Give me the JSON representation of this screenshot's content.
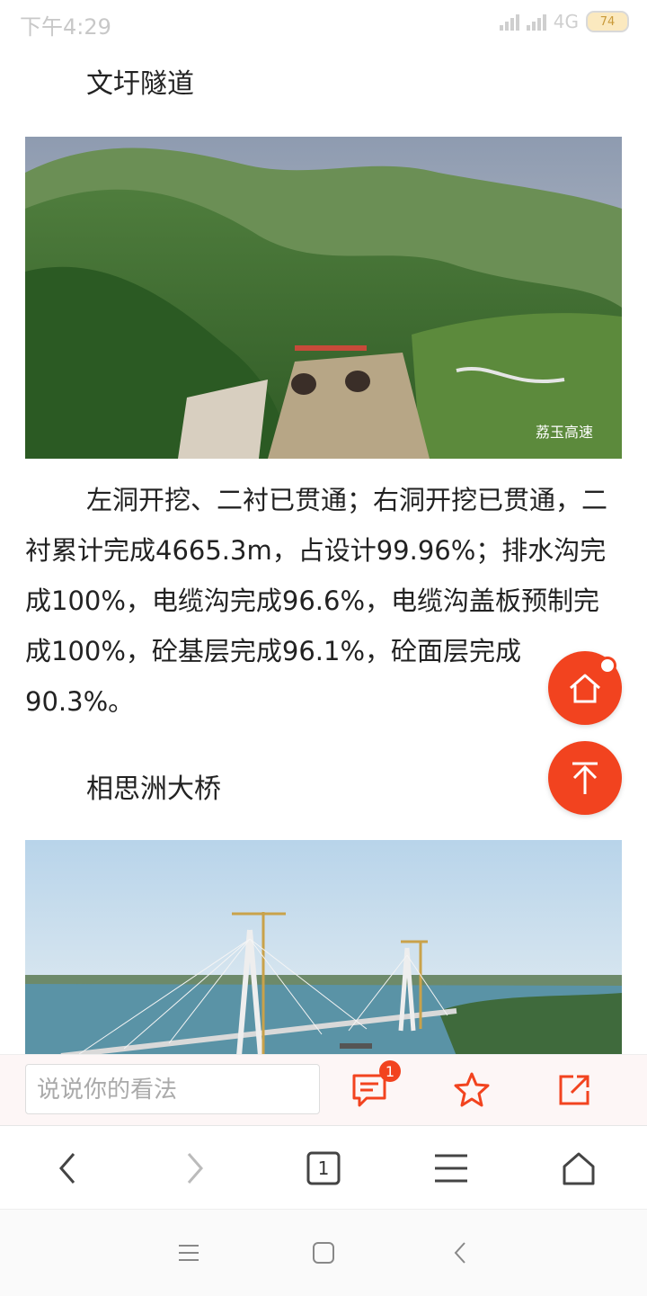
{
  "status_bar": {
    "time": "下午4:29",
    "network": "4G",
    "battery": "74"
  },
  "article": {
    "heading1": "文圩隧道",
    "image1_watermark": "荔玉高速",
    "paragraph": "左洞开挖、二衬已贯通；右洞开挖已贯通，二衬累计完成4665.3m，占设计99.96%；排水沟完成100%，电缆沟完成96.6%，电缆沟盖板预制完成100%，砼基层完成96.1%，砼面层完成90.3%。",
    "heading2": "相思洲大桥"
  },
  "comment_bar": {
    "placeholder": "说说你的看法",
    "comment_count": "1"
  },
  "browser_nav": {
    "tab_count": "1"
  },
  "colors": {
    "accent": "#f2431f"
  },
  "icons": [
    "home-icon",
    "back-to-top-icon",
    "comment-icon",
    "star-icon",
    "share-icon",
    "back-arrow-icon",
    "forward-arrow-icon",
    "tabs-icon",
    "menu-icon",
    "browser-home-icon",
    "system-menu-icon",
    "system-home-icon",
    "system-back-icon"
  ]
}
